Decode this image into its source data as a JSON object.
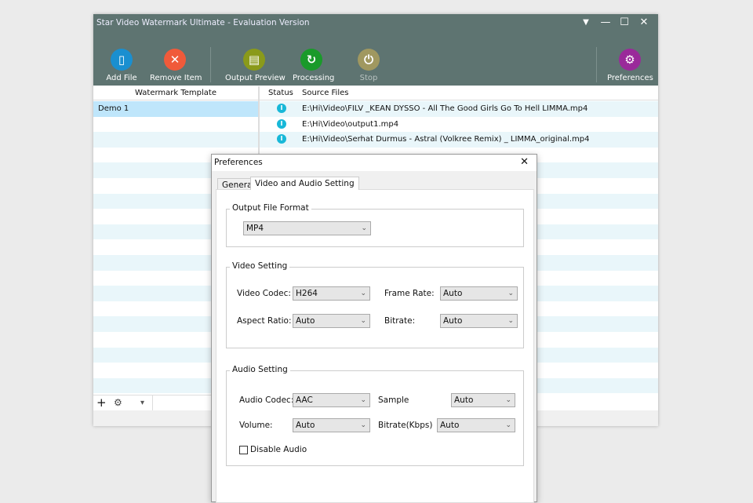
{
  "app": {
    "title": "Star Video Watermark Ultimate - Evaluation Version"
  },
  "window_controls": {
    "menu": "▼",
    "minimize": "—",
    "maximize": "☐",
    "close": "✕"
  },
  "toolbar": {
    "add_file": "Add File",
    "remove_item": "Remove Item",
    "output_preview": "Output Preview",
    "processing": "Processing",
    "stop": "Stop",
    "preferences": "Preferences"
  },
  "colors": {
    "add": "#1a8fd0",
    "remove": "#f05a3a",
    "preview": "#8a9a1a",
    "processing": "#1a9a2a",
    "stop": "#a09860",
    "preferences": "#9a2a9a"
  },
  "left_panel": {
    "header": "Watermark Template",
    "items": [
      "Demo 1"
    ]
  },
  "file_list": {
    "headers": {
      "status": "Status",
      "source": "Source Files"
    },
    "files": [
      "E:\\Hi\\Video\\FILV _KEAN DYSSO - All The Good Girls Go To Hell  LIMMA.mp4",
      "E:\\Hi\\Video\\output1.mp4",
      "E:\\Hi\\Video\\Serhat Durmus - Astral (Volkree Remix) _ LIMMA_original.mp4"
    ]
  },
  "bottom_toolbar": {
    "add": "+",
    "settings": "⚙",
    "dropdown": "▾"
  },
  "dialog": {
    "title": "Preferences",
    "close": "✕",
    "tabs": [
      "General",
      "Video and Audio Setting"
    ],
    "output": {
      "group": "Output File Format",
      "format": "MP4"
    },
    "video": {
      "group": "Video Setting",
      "codec_label": "Video Codec:",
      "codec": "H264",
      "frame_rate_label": "Frame Rate:",
      "frame_rate": "Auto",
      "aspect_label": "Aspect Ratio:",
      "aspect": "Auto",
      "bitrate_label": "Bitrate:",
      "bitrate": "Auto"
    },
    "audio": {
      "group": "Audio Setting",
      "codec_label": "Audio Codec:",
      "codec": "AAC",
      "sample_label": "Sample",
      "sample": "Auto",
      "volume_label": "Volume:",
      "volume": "Auto",
      "bitrate_label": "Bitrate(Kbps)",
      "bitrate": "Auto",
      "disable_label": "Disable Audio",
      "disable_checked": false
    }
  }
}
